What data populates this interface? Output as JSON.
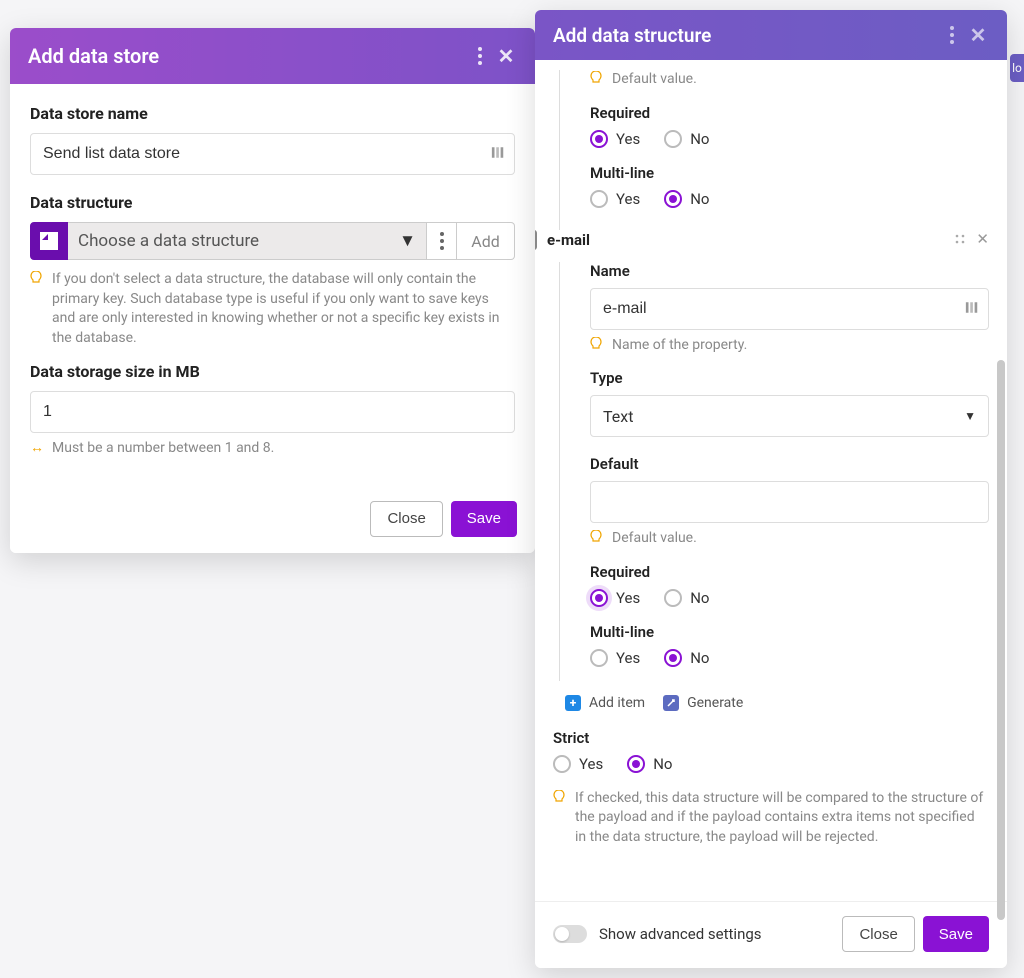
{
  "side_label": "lo",
  "left": {
    "title": "Add data store",
    "name_label": "Data store name",
    "name_value": "Send list data store",
    "ds_label": "Data structure",
    "ds_placeholder": "Choose a data structure",
    "ds_add": "Add",
    "ds_hint": "If you don't select a data structure, the database will only contain the primary key. Such database type is useful if you only want to save keys and are only interested in knowing whether or not a specific key exists in the database.",
    "size_label": "Data storage size in MB",
    "size_value": "1",
    "size_hint": "Must be a number between 1 and 8.",
    "close": "Close",
    "save": "Save"
  },
  "right": {
    "title": "Add data structure",
    "default_hint": "Default value.",
    "required_label": "Required",
    "multiline_label": "Multi-line",
    "yes": "Yes",
    "no": "No",
    "prop2": {
      "header": "e-mail",
      "name_label": "Name",
      "name_value": "e-mail",
      "name_hint": "Name of the property.",
      "type_label": "Type",
      "type_value": "Text",
      "default_label": "Default",
      "default_value": ""
    },
    "add_item": "Add item",
    "generate": "Generate",
    "strict_label": "Strict",
    "strict_hint": "If checked, this data structure will be compared to the structure of the payload and if the payload contains extra items not specified in the data structure, the payload will be rejected.",
    "show_advanced": "Show advanced settings",
    "close": "Close",
    "save": "Save"
  }
}
